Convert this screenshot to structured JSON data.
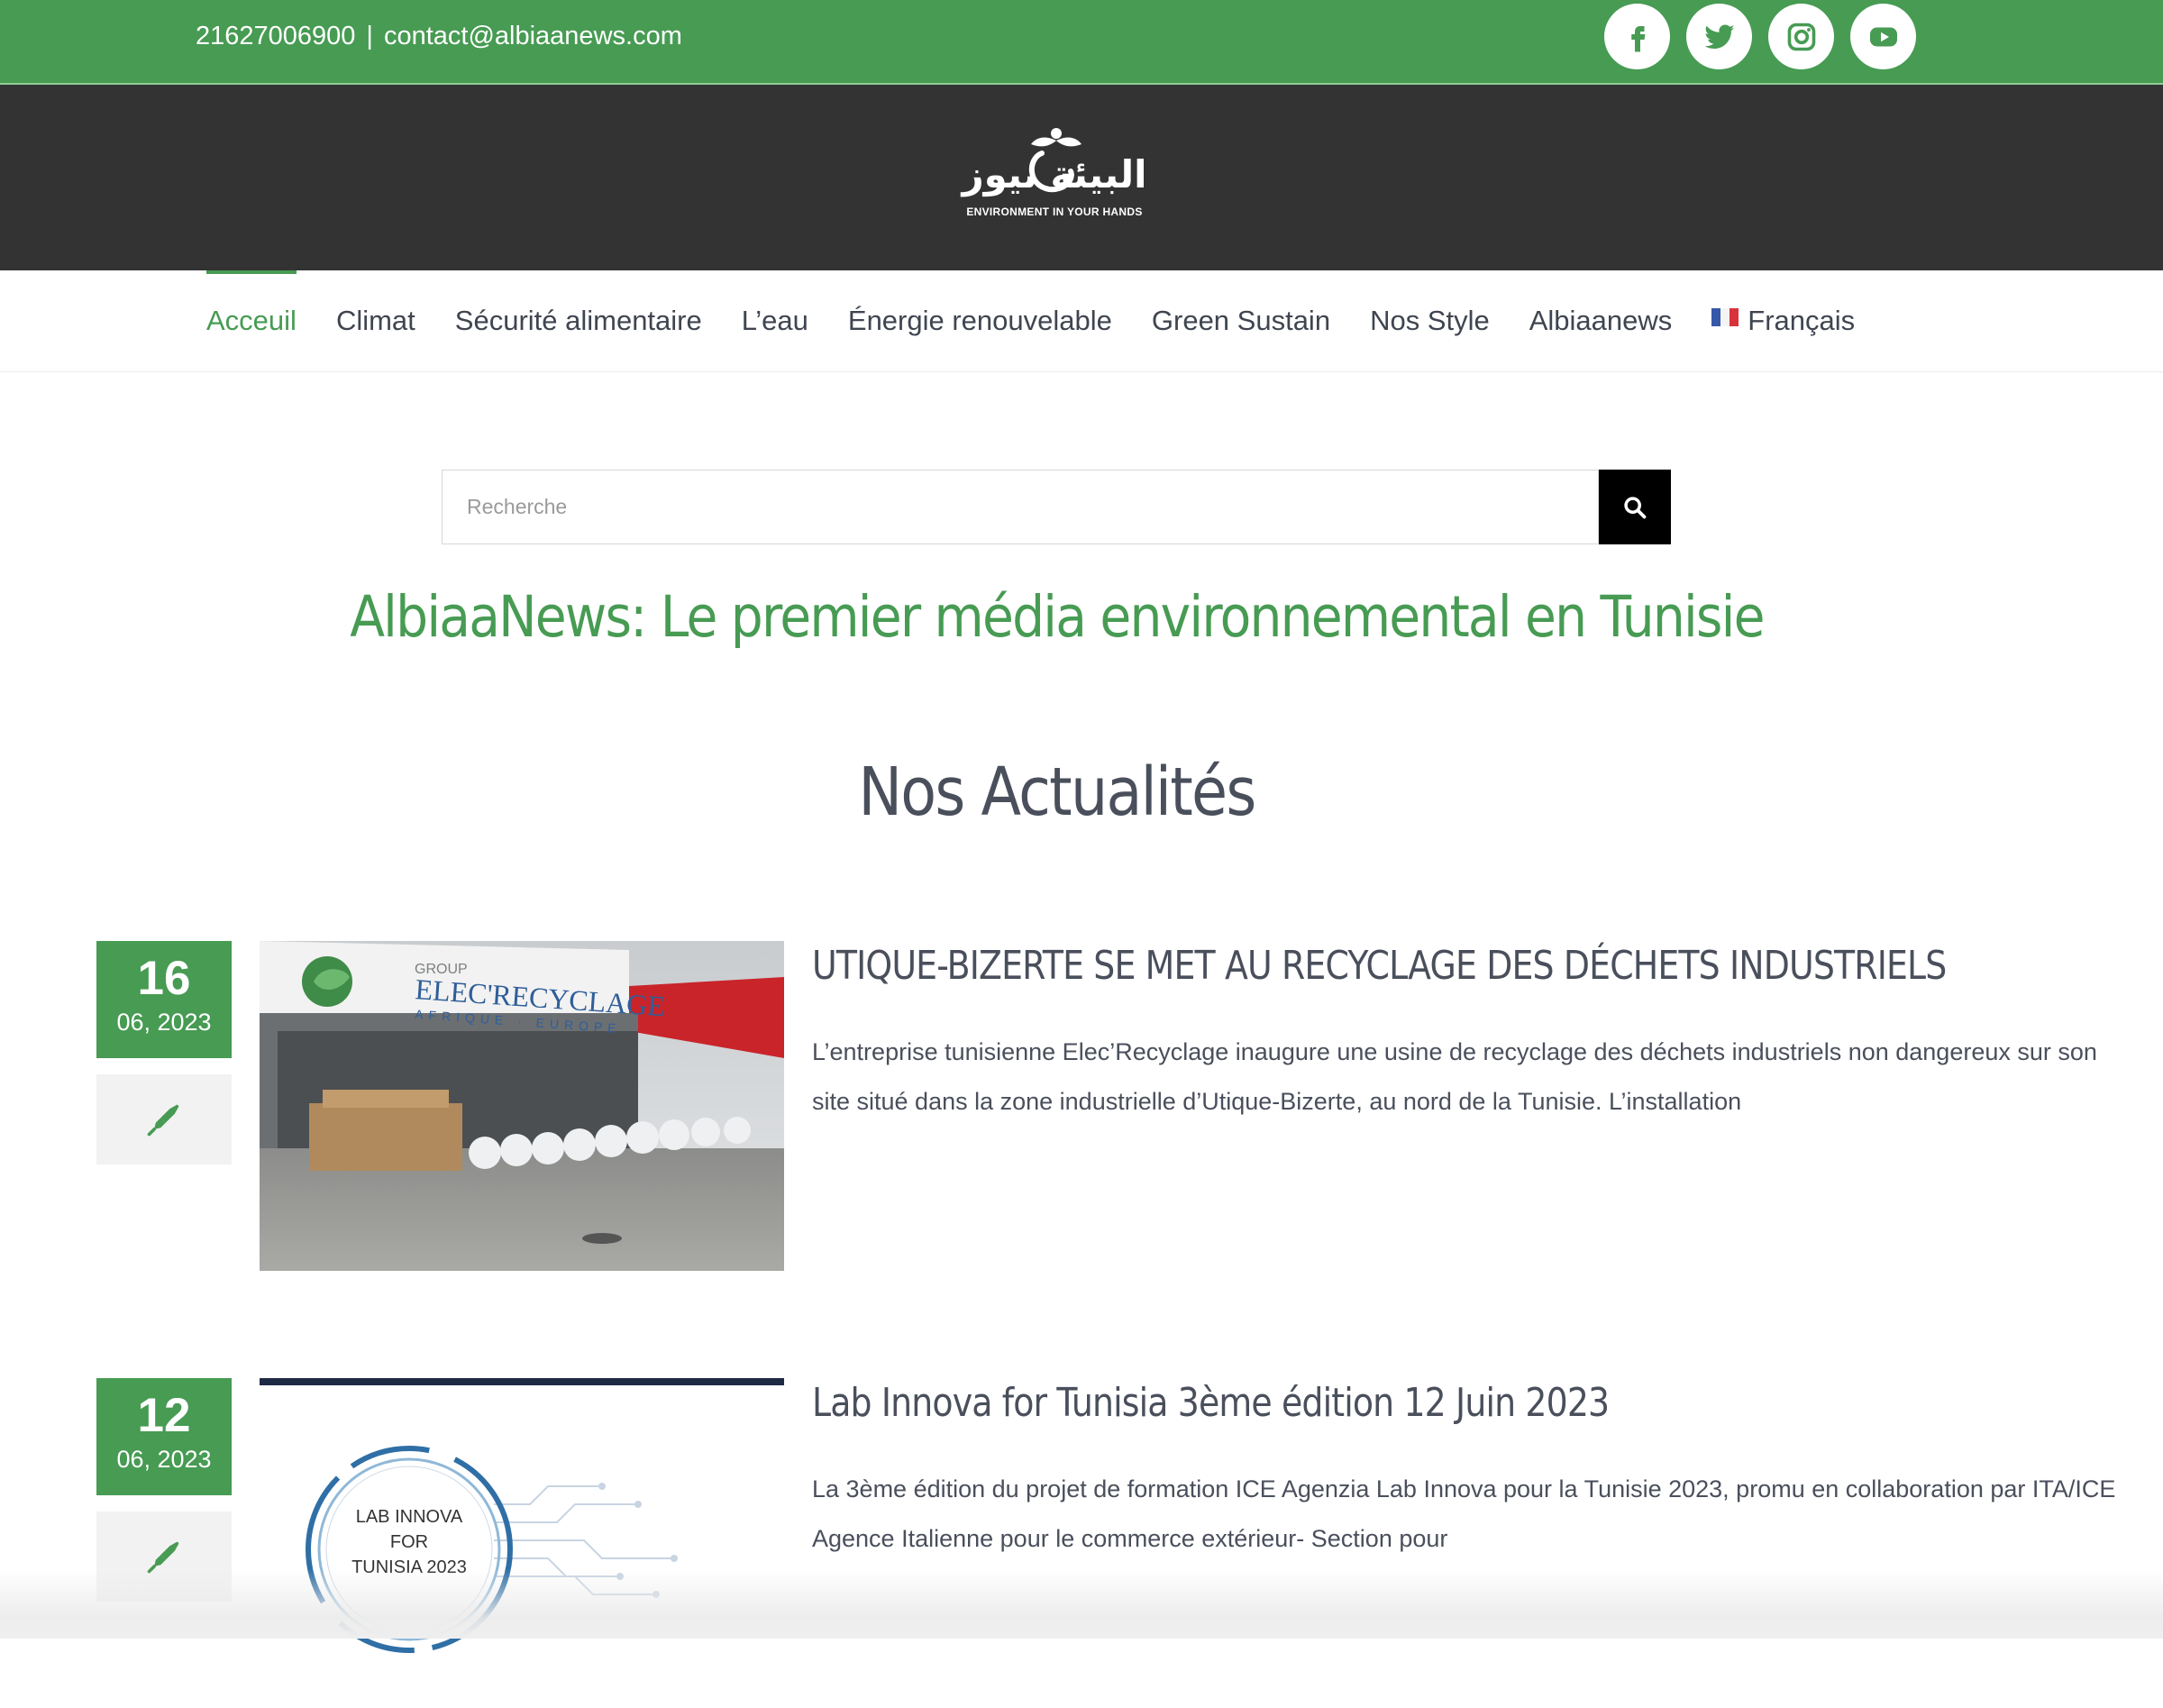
{
  "topbar": {
    "phone": "21627006900",
    "separator": "|",
    "email": "contact@albiaanews.com",
    "socials": [
      {
        "icon": "facebook-icon"
      },
      {
        "icon": "twitter-icon"
      },
      {
        "icon": "instagram-icon"
      },
      {
        "icon": "youtube-icon"
      }
    ]
  },
  "header": {
    "logo_text": "البيئة نيوز",
    "logo_tagline": "ENVIRONMENT IN YOUR HANDS"
  },
  "nav": {
    "items": [
      {
        "label": "Acceuil",
        "active": true
      },
      {
        "label": "Climat"
      },
      {
        "label": "Sécurité alimentaire"
      },
      {
        "label": "L’eau"
      },
      {
        "label": "Énergie renouvelable"
      },
      {
        "label": "Green Sustain"
      },
      {
        "label": "Nos Style"
      },
      {
        "label": "Albiaanews"
      },
      {
        "label": "Français",
        "icon": "french-flag-icon"
      }
    ]
  },
  "search": {
    "placeholder": "Recherche",
    "button_icon": "search-icon"
  },
  "main": {
    "tagline": "AlbiaaNews: Le premier média environnemental en Tunisie",
    "section_title": "Nos Actualités",
    "posts": [
      {
        "day": "16",
        "month_year": "06, 2023",
        "title": "UTIQUE-BIZERTE SE MET AU RECYCLAGE DES DÉCHETS INDUSTRIELS",
        "excerpt": "L’entreprise tunisienne Elec’Recyclage inaugure une usine de recyclage des déchets industriels non dangereux sur son site situé dans la zone industrielle d’Utique-Bizerte, au nord de la Tunisie. L’installation",
        "image_sign_lines": [
          "GROUP",
          "ELEC'RECYCLAGE",
          "AFRIQUE · EUROPE"
        ]
      },
      {
        "day": "12",
        "month_year": "06, 2023",
        "title": "Lab Innova for Tunisia 3ème édition 12 Juin 2023",
        "excerpt": "La 3ème édition du projet de formation ICE Agenzia Lab Innova pour la Tunisie 2023, promu en collaboration par ITA/ICE Agence Italienne pour le commerce extérieur- Section pour",
        "image_badge_lines": [
          "LAB INNOVA",
          "FOR",
          "TUNISIA 2023"
        ]
      }
    ]
  },
  "colors": {
    "brand_green": "#479b53",
    "header_dark": "#333333",
    "text_dark": "#4a4f5c"
  }
}
